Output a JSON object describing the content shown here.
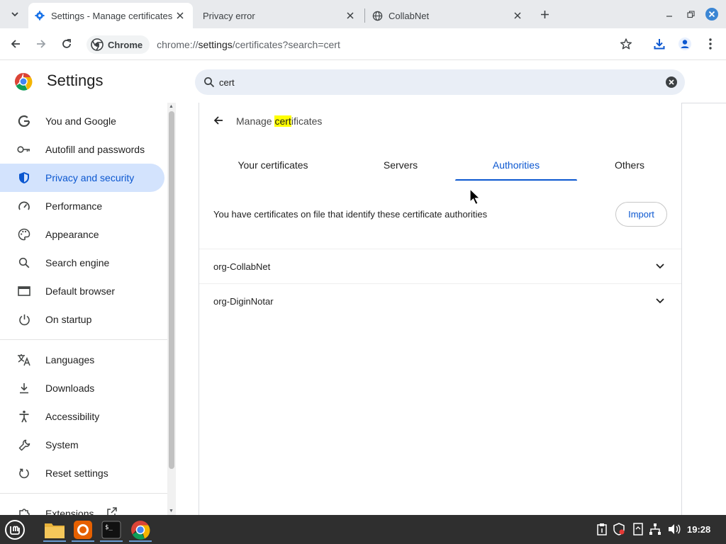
{
  "tabs": [
    {
      "title": "Settings - Manage certificates",
      "active": true,
      "icon": "settings-gear-icon"
    },
    {
      "title": "Privacy error",
      "active": false,
      "icon": "none"
    },
    {
      "title": "CollabNet",
      "active": false,
      "icon": "globe-icon"
    }
  ],
  "toolbar": {
    "chip_label": "Chrome",
    "url_prefix": "chrome://",
    "url_main": "settings",
    "url_suffix": "/certificates?search=cert"
  },
  "settings": {
    "title": "Settings",
    "search_value": "cert"
  },
  "sidebar": {
    "items": [
      {
        "label": "You and Google",
        "icon": "google-g-icon"
      },
      {
        "label": "Autofill and passwords",
        "icon": "key-icon"
      },
      {
        "label": "Privacy and security",
        "icon": "shield-icon",
        "active": true
      },
      {
        "label": "Performance",
        "icon": "speedometer-icon"
      },
      {
        "label": "Appearance",
        "icon": "palette-icon"
      },
      {
        "label": "Search engine",
        "icon": "search-icon"
      },
      {
        "label": "Default browser",
        "icon": "browser-window-icon"
      },
      {
        "label": "On startup",
        "icon": "power-icon"
      },
      {
        "label": "Languages",
        "icon": "translate-icon"
      },
      {
        "label": "Downloads",
        "icon": "download-icon"
      },
      {
        "label": "Accessibility",
        "icon": "accessibility-icon"
      },
      {
        "label": "System",
        "icon": "wrench-icon"
      },
      {
        "label": "Reset settings",
        "icon": "reset-icon"
      },
      {
        "label": "Extensions",
        "icon": "puzzle-icon"
      }
    ]
  },
  "content": {
    "title_before": "Manage ",
    "title_highlight": "cert",
    "title_after": "ificates",
    "tabs": [
      "Your certificates",
      "Servers",
      "Authorities",
      "Others"
    ],
    "active_tab": "Authorities",
    "description": "You have certificates on file that identify these certificate authorities",
    "import_label": "Import",
    "authorities": [
      "org-CollabNet",
      "org-DiginNotar"
    ]
  },
  "taskbar": {
    "clock": "19:28",
    "apps": [
      "files",
      "firefox",
      "terminal",
      "chrome"
    ]
  },
  "colors": {
    "accent": "#0b57d0",
    "active_nav_bg": "#d3e3fd",
    "search_bg": "#e9eef6",
    "highlight": "#ffff00",
    "taskbar": "#2f2f2f"
  }
}
